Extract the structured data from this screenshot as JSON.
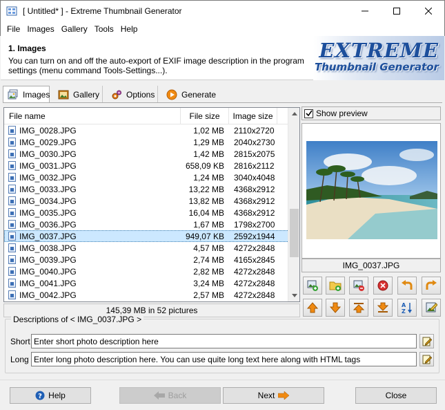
{
  "window": {
    "title": "[ Untitled* ] - Extreme Thumbnail Generator",
    "minimize": "—",
    "maximize": "☐",
    "close": "✕"
  },
  "menu": [
    "File",
    "Images",
    "Gallery",
    "Tools",
    "Help"
  ],
  "header": {
    "title": "1. Images",
    "description": "You can turn on and off the auto-export of EXIF image description in the program settings (menu command Tools-Settings...).",
    "logo_line1": "EXTREME",
    "logo_line2": "Thumbnail Generator"
  },
  "tabs": [
    {
      "label": "Images",
      "icon": "images-icon",
      "active": true
    },
    {
      "label": "Gallery",
      "icon": "gallery-icon",
      "active": false
    },
    {
      "label": "Options",
      "icon": "options-icon",
      "active": false
    },
    {
      "label": "Generate",
      "icon": "generate-icon",
      "active": false
    }
  ],
  "filelist": {
    "columns": [
      "File name",
      "File size",
      "Image size"
    ],
    "rows": [
      {
        "name": "IMG_0028.JPG",
        "size": "1,02 MB",
        "dim": "2110x2720"
      },
      {
        "name": "IMG_0029.JPG",
        "size": "1,29 MB",
        "dim": "2040x2730"
      },
      {
        "name": "IMG_0030.JPG",
        "size": "1,42 MB",
        "dim": "2815x2075"
      },
      {
        "name": "IMG_0031.JPG",
        "size": "658,09 KB",
        "dim": "2816x2112"
      },
      {
        "name": "IMG_0032.JPG",
        "size": "1,24 MB",
        "dim": "3040x4048"
      },
      {
        "name": "IMG_0033.JPG",
        "size": "13,22 MB",
        "dim": "4368x2912"
      },
      {
        "name": "IMG_0034.JPG",
        "size": "13,82 MB",
        "dim": "4368x2912"
      },
      {
        "name": "IMG_0035.JPG",
        "size": "16,04 MB",
        "dim": "4368x2912"
      },
      {
        "name": "IMG_0036.JPG",
        "size": "1,67 MB",
        "dim": "1798x2700"
      },
      {
        "name": "IMG_0037.JPG",
        "size": "949,07 KB",
        "dim": "2592x1944",
        "selected": true
      },
      {
        "name": "IMG_0038.JPG",
        "size": "4,57 MB",
        "dim": "4272x2848"
      },
      {
        "name": "IMG_0039.JPG",
        "size": "2,74 MB",
        "dim": "4165x2845"
      },
      {
        "name": "IMG_0040.JPG",
        "size": "2,82 MB",
        "dim": "4272x2848"
      },
      {
        "name": "IMG_0041.JPG",
        "size": "3,24 MB",
        "dim": "4272x2848"
      },
      {
        "name": "IMG_0042.JPG",
        "size": "2,57 MB",
        "dim": "4272x2848"
      }
    ],
    "summary": "145,39 MB in 52 pictures"
  },
  "preview": {
    "show_label": "Show preview",
    "checked": true,
    "caption": "IMG_0037.JPG"
  },
  "descriptions": {
    "legend": "Descriptions of < IMG_0037.JPG >",
    "short_label": "Short",
    "short_value": "Enter short photo description here",
    "long_label": "Long",
    "long_value": "Enter long photo description here. You can use quite long text here along with HTML tags"
  },
  "buttons": {
    "help": "Help",
    "back": "Back",
    "next": "Next",
    "close": "Close"
  },
  "colors": {
    "selection": "#cce8ff",
    "accent_orange": "#f08a12",
    "help_blue": "#1f5fb5"
  }
}
